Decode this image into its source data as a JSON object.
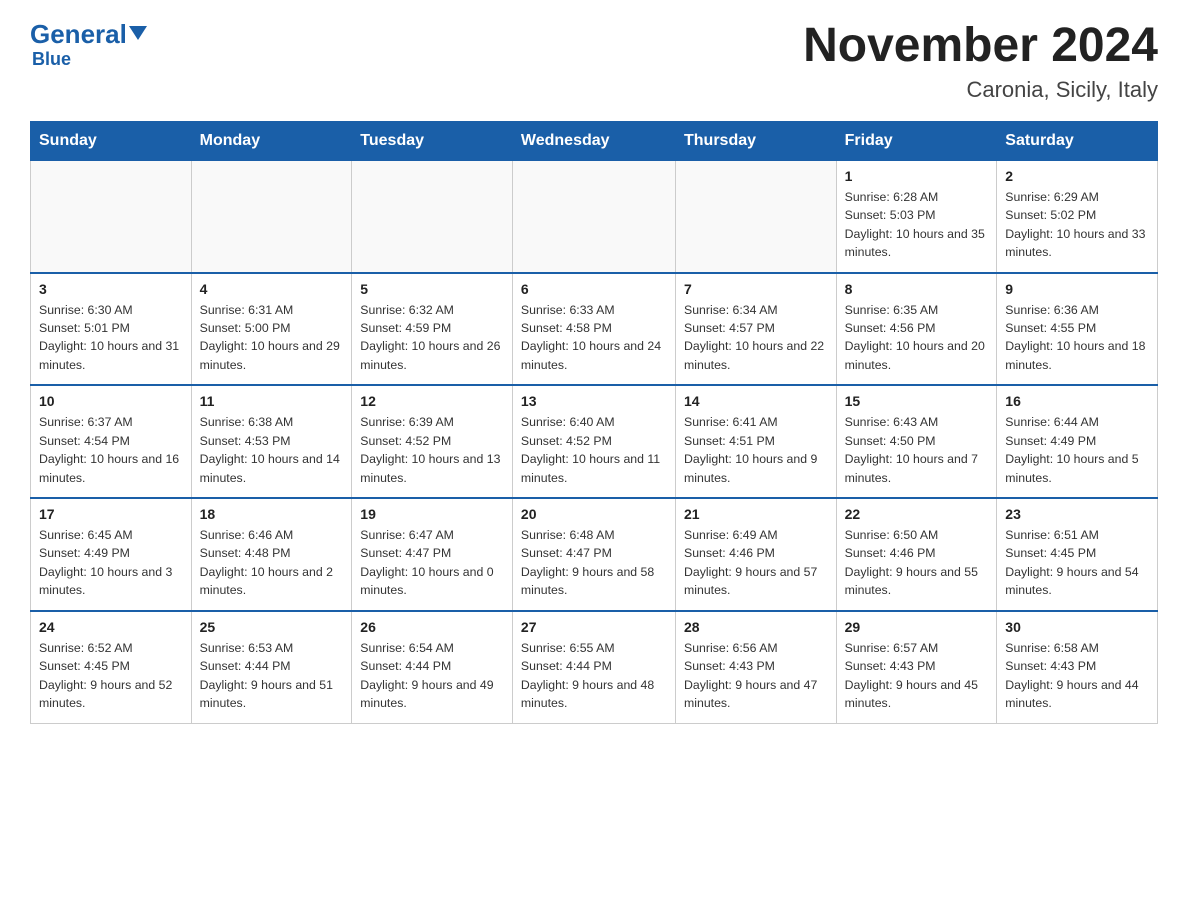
{
  "header": {
    "logo_top": "General",
    "logo_accent": "Blue",
    "title": "November 2024",
    "subtitle": "Caronia, Sicily, Italy"
  },
  "weekdays": [
    "Sunday",
    "Monday",
    "Tuesday",
    "Wednesday",
    "Thursday",
    "Friday",
    "Saturday"
  ],
  "weeks": [
    [
      {
        "day": "",
        "info": ""
      },
      {
        "day": "",
        "info": ""
      },
      {
        "day": "",
        "info": ""
      },
      {
        "day": "",
        "info": ""
      },
      {
        "day": "",
        "info": ""
      },
      {
        "day": "1",
        "info": "Sunrise: 6:28 AM\nSunset: 5:03 PM\nDaylight: 10 hours and 35 minutes."
      },
      {
        "day": "2",
        "info": "Sunrise: 6:29 AM\nSunset: 5:02 PM\nDaylight: 10 hours and 33 minutes."
      }
    ],
    [
      {
        "day": "3",
        "info": "Sunrise: 6:30 AM\nSunset: 5:01 PM\nDaylight: 10 hours and 31 minutes."
      },
      {
        "day": "4",
        "info": "Sunrise: 6:31 AM\nSunset: 5:00 PM\nDaylight: 10 hours and 29 minutes."
      },
      {
        "day": "5",
        "info": "Sunrise: 6:32 AM\nSunset: 4:59 PM\nDaylight: 10 hours and 26 minutes."
      },
      {
        "day": "6",
        "info": "Sunrise: 6:33 AM\nSunset: 4:58 PM\nDaylight: 10 hours and 24 minutes."
      },
      {
        "day": "7",
        "info": "Sunrise: 6:34 AM\nSunset: 4:57 PM\nDaylight: 10 hours and 22 minutes."
      },
      {
        "day": "8",
        "info": "Sunrise: 6:35 AM\nSunset: 4:56 PM\nDaylight: 10 hours and 20 minutes."
      },
      {
        "day": "9",
        "info": "Sunrise: 6:36 AM\nSunset: 4:55 PM\nDaylight: 10 hours and 18 minutes."
      }
    ],
    [
      {
        "day": "10",
        "info": "Sunrise: 6:37 AM\nSunset: 4:54 PM\nDaylight: 10 hours and 16 minutes."
      },
      {
        "day": "11",
        "info": "Sunrise: 6:38 AM\nSunset: 4:53 PM\nDaylight: 10 hours and 14 minutes."
      },
      {
        "day": "12",
        "info": "Sunrise: 6:39 AM\nSunset: 4:52 PM\nDaylight: 10 hours and 13 minutes."
      },
      {
        "day": "13",
        "info": "Sunrise: 6:40 AM\nSunset: 4:52 PM\nDaylight: 10 hours and 11 minutes."
      },
      {
        "day": "14",
        "info": "Sunrise: 6:41 AM\nSunset: 4:51 PM\nDaylight: 10 hours and 9 minutes."
      },
      {
        "day": "15",
        "info": "Sunrise: 6:43 AM\nSunset: 4:50 PM\nDaylight: 10 hours and 7 minutes."
      },
      {
        "day": "16",
        "info": "Sunrise: 6:44 AM\nSunset: 4:49 PM\nDaylight: 10 hours and 5 minutes."
      }
    ],
    [
      {
        "day": "17",
        "info": "Sunrise: 6:45 AM\nSunset: 4:49 PM\nDaylight: 10 hours and 3 minutes."
      },
      {
        "day": "18",
        "info": "Sunrise: 6:46 AM\nSunset: 4:48 PM\nDaylight: 10 hours and 2 minutes."
      },
      {
        "day": "19",
        "info": "Sunrise: 6:47 AM\nSunset: 4:47 PM\nDaylight: 10 hours and 0 minutes."
      },
      {
        "day": "20",
        "info": "Sunrise: 6:48 AM\nSunset: 4:47 PM\nDaylight: 9 hours and 58 minutes."
      },
      {
        "day": "21",
        "info": "Sunrise: 6:49 AM\nSunset: 4:46 PM\nDaylight: 9 hours and 57 minutes."
      },
      {
        "day": "22",
        "info": "Sunrise: 6:50 AM\nSunset: 4:46 PM\nDaylight: 9 hours and 55 minutes."
      },
      {
        "day": "23",
        "info": "Sunrise: 6:51 AM\nSunset: 4:45 PM\nDaylight: 9 hours and 54 minutes."
      }
    ],
    [
      {
        "day": "24",
        "info": "Sunrise: 6:52 AM\nSunset: 4:45 PM\nDaylight: 9 hours and 52 minutes."
      },
      {
        "day": "25",
        "info": "Sunrise: 6:53 AM\nSunset: 4:44 PM\nDaylight: 9 hours and 51 minutes."
      },
      {
        "day": "26",
        "info": "Sunrise: 6:54 AM\nSunset: 4:44 PM\nDaylight: 9 hours and 49 minutes."
      },
      {
        "day": "27",
        "info": "Sunrise: 6:55 AM\nSunset: 4:44 PM\nDaylight: 9 hours and 48 minutes."
      },
      {
        "day": "28",
        "info": "Sunrise: 6:56 AM\nSunset: 4:43 PM\nDaylight: 9 hours and 47 minutes."
      },
      {
        "day": "29",
        "info": "Sunrise: 6:57 AM\nSunset: 4:43 PM\nDaylight: 9 hours and 45 minutes."
      },
      {
        "day": "30",
        "info": "Sunrise: 6:58 AM\nSunset: 4:43 PM\nDaylight: 9 hours and 44 minutes."
      }
    ]
  ]
}
